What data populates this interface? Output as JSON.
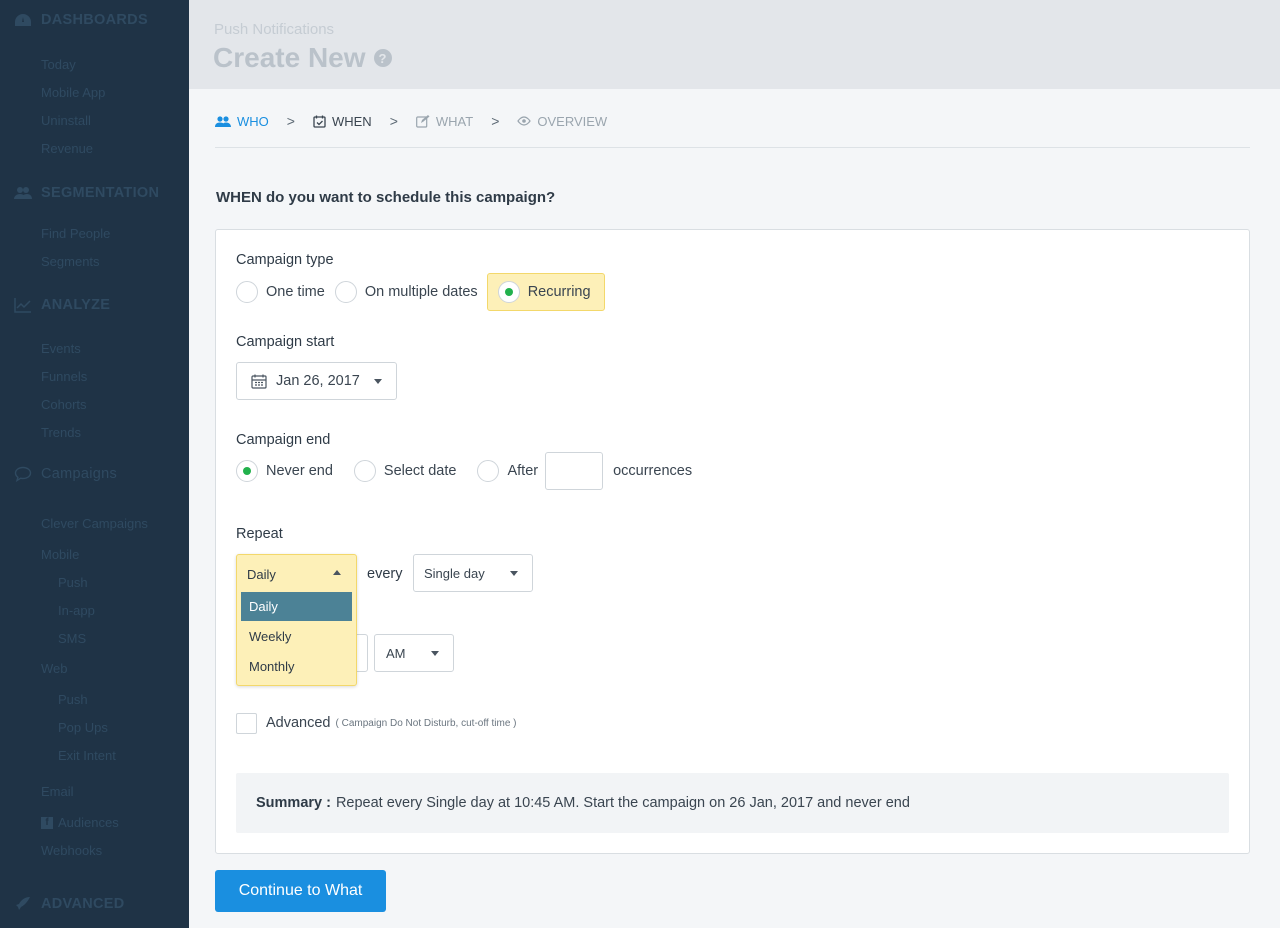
{
  "sidebar": {
    "dashboards": {
      "title": "DASHBOARDS",
      "items": [
        "Today",
        "Mobile App",
        "Uninstall",
        "Revenue"
      ]
    },
    "segmentation": {
      "title": "SEGMENTATION",
      "items": [
        "Find People",
        "Segments"
      ]
    },
    "analyze": {
      "title": "ANALYZE",
      "items": [
        "Events",
        "Funnels",
        "Cohorts",
        "Trends"
      ]
    },
    "campaigns": {
      "title": "Campaigns",
      "clever": "Clever Campaigns",
      "mobile": "Mobile",
      "mobile_items": [
        "Push",
        "In-app",
        "SMS"
      ],
      "web": "Web",
      "web_items": [
        "Push",
        "Pop Ups",
        "Exit Intent"
      ],
      "email": "Email",
      "audiences": "Audiences",
      "webhooks": "Webhooks"
    },
    "advanced": {
      "title": "ADVANCED"
    }
  },
  "header": {
    "breadcrumb": "Push Notifications",
    "title": "Create New",
    "help": "?"
  },
  "steps": [
    {
      "label": "WHO",
      "icon": "users-icon"
    },
    {
      "label": "WHEN",
      "icon": "calendar-check-icon"
    },
    {
      "label": "WHAT",
      "icon": "edit-icon"
    },
    {
      "label": "OVERVIEW",
      "icon": "eye-icon"
    }
  ],
  "step_separator": ">",
  "question": "WHEN do you want to schedule this campaign?",
  "form": {
    "campaign_type": {
      "label": "Campaign type",
      "options": [
        "One time",
        "On multiple dates",
        "Recurring"
      ],
      "selected": "Recurring"
    },
    "campaign_start": {
      "label": "Campaign start",
      "value": "Jan 26, 2017"
    },
    "campaign_end": {
      "label": "Campaign end",
      "options": [
        "Never end",
        "Select date",
        "After"
      ],
      "selected": "Never end",
      "occurrences_value": "",
      "occurrences_label": "occurrences"
    },
    "repeat": {
      "label": "Repeat",
      "value": "Daily",
      "options": [
        "Daily",
        "Weekly",
        "Monthly"
      ],
      "every_label": "every",
      "every_value": "Single day"
    },
    "time": {
      "ampm": "AM"
    },
    "advanced": {
      "label": "Advanced",
      "note": "( Campaign Do Not Disturb, cut-off time )"
    }
  },
  "summary": {
    "label": "Summary :",
    "text": "Repeat every Single day at 10:45 AM. Start the campaign on 26 Jan, 2017 and never end"
  },
  "cta": "Continue to What",
  "colors": {
    "sidebar_bg": "#1f3346",
    "accent": "#1a8fe0",
    "radio_on": "#22b14c",
    "highlight": "#fdf0b8",
    "dropdown_selected": "#4c8296"
  }
}
